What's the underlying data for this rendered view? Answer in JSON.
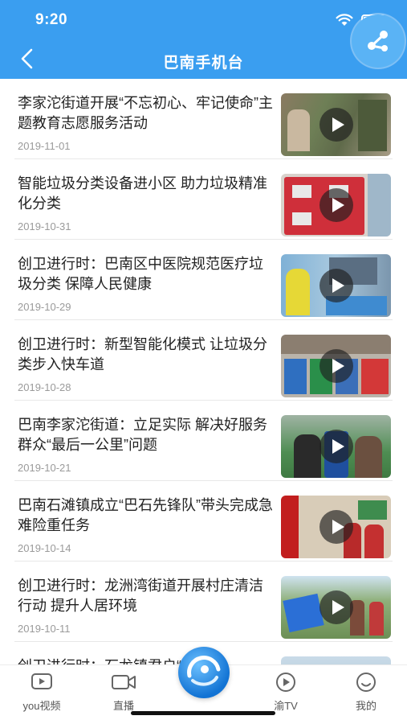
{
  "status": {
    "time": "9:20"
  },
  "header": {
    "title": "巴南手机台"
  },
  "news": [
    {
      "title": "李家沱街道开展“不忘初心、牢记使命”主题教育志愿服务活动",
      "date": "2019-11-01"
    },
    {
      "title": "智能垃圾分类设备进小区 助力垃圾精准化分类",
      "date": "2019-10-31"
    },
    {
      "title": "创卫进行时：巴南区中医院规范医疗垃圾分类 保障人民健康",
      "date": "2019-10-29"
    },
    {
      "title": "创卫进行时：新型智能化模式 让垃圾分类步入快车道",
      "date": "2019-10-28"
    },
    {
      "title": "巴南李家沱街道：立足实际 解决好服务群众“最后一公里”问题",
      "date": "2019-10-21"
    },
    {
      "title": "巴南石滩镇成立“巴石先锋队”带头完成急难险重任务",
      "date": "2019-10-14"
    },
    {
      "title": "创卫进行时：龙洲湾街道开展村庄清洁行动 提升人居环境",
      "date": "2019-10-11"
    },
    {
      "title": "创卫进行时：石龙镇君户“清",
      "date": ""
    }
  ],
  "tabs": [
    {
      "label": "you视频"
    },
    {
      "label": "直播"
    },
    {
      "label": "渝TV"
    },
    {
      "label": "我的"
    }
  ]
}
